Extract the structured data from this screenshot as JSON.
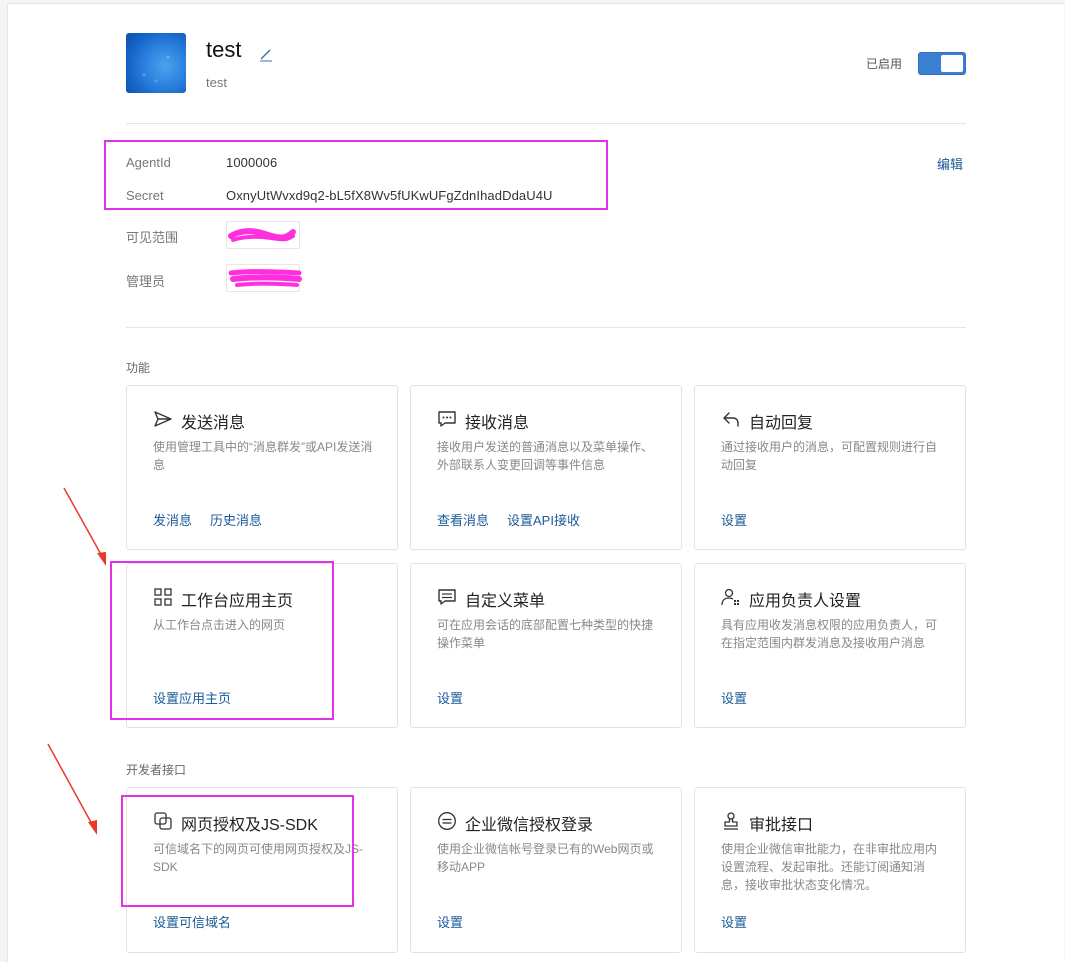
{
  "header": {
    "app_name": "test",
    "app_desc": "test",
    "status_label": "已启用",
    "toggle_on": true
  },
  "info": {
    "edit_label": "编辑",
    "rows": [
      {
        "label": "AgentId",
        "value": "1000006"
      },
      {
        "label": "Secret",
        "value": "OxnyUtWvxd9q2-bL5fX8Wv5fUKwUFgZdnIhadDdaU4U"
      },
      {
        "label": "可见范围",
        "value": ""
      },
      {
        "label": "管理员",
        "value": ""
      }
    ]
  },
  "sections": {
    "features_title": "功能",
    "dev_title": "开发者接口"
  },
  "cards": [
    {
      "icon": "send-icon",
      "title": "发送消息",
      "desc": "使用管理工具中的“消息群发”或API发送消息",
      "actions": [
        "发消息",
        "历史消息"
      ]
    },
    {
      "icon": "chat-bubble-icon",
      "title": "接收消息",
      "desc": "接收用户发送的普通消息以及菜单操作、外部联系人变更回调等事件信息",
      "actions": [
        "查看消息",
        "设置API接收"
      ]
    },
    {
      "icon": "reply-icon",
      "title": "自动回复",
      "desc": "通过接收用户的消息，可配置规则进行自动回复",
      "actions": [
        "设置"
      ]
    },
    {
      "icon": "grid-icon",
      "title": "工作台应用主页",
      "desc": "从工作台点击进入的网页",
      "actions": [
        "设置应用主页"
      ]
    },
    {
      "icon": "menu-icon",
      "title": "自定义菜单",
      "desc": "可在应用会话的底部配置七种类型的快捷操作菜单",
      "actions": [
        "设置"
      ]
    },
    {
      "icon": "user-gear-icon",
      "title": "应用负责人设置",
      "desc": "具有应用收发消息权限的应用负责人，可在指定范围内群发消息及接收用户消息",
      "actions": [
        "设置"
      ]
    },
    {
      "icon": "link-squares-icon",
      "title": "网页授权及JS-SDK",
      "desc": "可信域名下的网页可使用网页授权及JS-SDK",
      "actions": [
        "设置可信域名"
      ]
    },
    {
      "icon": "wechat-login-icon",
      "title": "企业微信授权登录",
      "desc": "使用企业微信帐号登录已有的Web网页或移动APP",
      "actions": [
        "设置"
      ]
    },
    {
      "icon": "stamp-icon",
      "title": "审批接口",
      "desc": "使用企业微信审批能力，在非审批应用内设置流程、发起审批。还能订阅通知消息，接收审批状态变化情况。",
      "actions": [
        "设置"
      ]
    }
  ],
  "colors": {
    "accent": "#1a5a99",
    "toggle": "#3a7fd2",
    "highlight_box": "#e033e6",
    "arrow": "#e83a2a",
    "redaction": "#ff2fe0"
  }
}
